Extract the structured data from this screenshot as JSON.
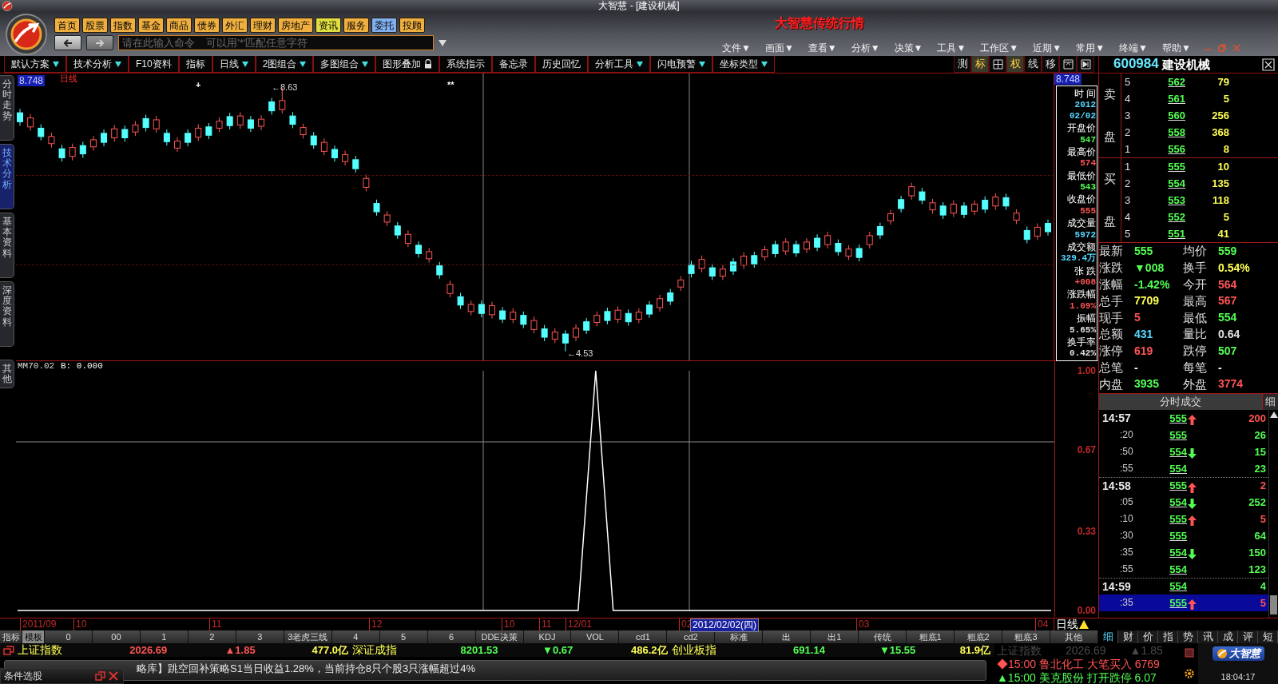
{
  "window": {
    "title": "大智慧 - [建设机械]"
  },
  "nav_buttons": [
    {
      "label": "首页",
      "color": "#f0b040"
    },
    {
      "label": "股票",
      "color": "#f0b040"
    },
    {
      "label": "指数",
      "color": "#f0b040"
    },
    {
      "label": "基金",
      "color": "#f0b040"
    },
    {
      "label": "商品",
      "color": "#f0b040"
    },
    {
      "label": "债券",
      "color": "#f0b040"
    },
    {
      "label": "外汇",
      "color": "#f0b040"
    },
    {
      "label": "理财",
      "color": "#f0b040"
    },
    {
      "label": "房地产",
      "color": "#f0b040"
    },
    {
      "label": "资讯",
      "color": "#e0e040"
    },
    {
      "label": "服务",
      "color": "#f0b040"
    },
    {
      "label": "委托",
      "color": "#80b0f0"
    },
    {
      "label": "投顾",
      "color": "#f0b040"
    }
  ],
  "command": {
    "placeholder": "请在此输入命令    可以用'*'匹配任意字符"
  },
  "brand": "大智慧传统行情",
  "menus": [
    "文件▼",
    "画面▼",
    "查看▼",
    "分析▼",
    "决策▼",
    "工具▼",
    "工作区▼",
    "近期▼",
    "常用▼",
    "终端▼",
    "帮助▼"
  ],
  "toolbar": [
    {
      "label": "默认方案",
      "dropdown": true,
      "lock": false
    },
    {
      "label": "技术分析",
      "dropdown": true,
      "lock": false
    },
    {
      "label": "F10资料",
      "dropdown": false,
      "lock": false
    },
    {
      "label": "指标",
      "dropdown": false,
      "lock": false
    },
    {
      "label": "日线",
      "dropdown": true,
      "lock": false
    },
    {
      "label": "2图组合",
      "dropdown": true,
      "lock": false
    },
    {
      "label": "多图组合",
      "dropdown": true,
      "lock": false
    },
    {
      "label": "图形叠加",
      "dropdown": false,
      "lock": true
    },
    {
      "label": "系统指示",
      "dropdown": false,
      "lock": false
    },
    {
      "label": "备忘录",
      "dropdown": false,
      "lock": false
    },
    {
      "label": "历史回忆",
      "dropdown": false,
      "lock": false
    },
    {
      "label": "分析工具",
      "dropdown": true,
      "lock": false
    },
    {
      "label": "闪电预警",
      "dropdown": true,
      "lock": false
    },
    {
      "label": "坐标类型",
      "dropdown": true,
      "lock": false
    }
  ],
  "chart_tools": [
    {
      "kind": "text",
      "label": "测",
      "selected": false
    },
    {
      "kind": "text",
      "label": "标",
      "selected": true
    },
    {
      "kind": "grid",
      "selected": false
    },
    {
      "kind": "text",
      "label": "权",
      "selected": true
    },
    {
      "kind": "text",
      "label": "线",
      "selected": false
    },
    {
      "kind": "text",
      "label": "移",
      "selected": false
    },
    {
      "kind": "panel",
      "selected": false
    },
    {
      "kind": "play",
      "selected": false
    }
  ],
  "stock": {
    "code": "600984",
    "name": "建设机械"
  },
  "side_tabs": [
    {
      "label": "分时走势",
      "selected": false
    },
    {
      "label": "技术分析",
      "selected": true
    },
    {
      "label": "基本资料",
      "selected": false
    },
    {
      "label": "深度资料",
      "selected": false
    }
  ],
  "lower_tab": "其他",
  "price_chart": {
    "period": "日线",
    "top_price": "8.748",
    "high": "←8.63",
    "low": "←4.53",
    "markers": [
      "+",
      "**"
    ],
    "chart_data": {
      "type": "candlestick",
      "ylim": [
        4.39,
        8.85
      ],
      "ohlc": [
        [
          8.24,
          8.3,
          8.04,
          8.1
        ],
        [
          8.02,
          8.22,
          7.96,
          8.16
        ],
        [
          8.0,
          8.06,
          7.81,
          7.87
        ],
        [
          7.76,
          7.93,
          7.7,
          7.87
        ],
        [
          7.68,
          7.74,
          7.48,
          7.54
        ],
        [
          7.56,
          7.76,
          7.5,
          7.7
        ],
        [
          7.73,
          7.79,
          7.54,
          7.6
        ],
        [
          7.71,
          7.88,
          7.65,
          7.82
        ],
        [
          7.92,
          7.98,
          7.72,
          7.78
        ],
        [
          7.85,
          8.05,
          7.79,
          7.99
        ],
        [
          7.98,
          8.04,
          7.79,
          7.85
        ],
        [
          7.94,
          8.11,
          7.88,
          8.05
        ],
        [
          8.15,
          8.21,
          7.95,
          8.01
        ],
        [
          7.99,
          8.19,
          7.93,
          8.13
        ],
        [
          7.92,
          7.98,
          7.73,
          7.79
        ],
        [
          7.69,
          7.86,
          7.63,
          7.8
        ],
        [
          7.92,
          7.98,
          7.72,
          7.78
        ],
        [
          7.86,
          8.06,
          7.8,
          8.0
        ],
        [
          8.02,
          8.08,
          7.83,
          7.89
        ],
        [
          8.0,
          8.17,
          7.94,
          8.11
        ],
        [
          8.18,
          8.24,
          7.98,
          8.04
        ],
        [
          8.05,
          8.25,
          7.99,
          8.19
        ],
        [
          8.13,
          8.19,
          7.94,
          8.0
        ],
        [
          8.03,
          8.2,
          7.97,
          8.14
        ],
        [
          8.41,
          8.47,
          8.21,
          8.27
        ],
        [
          8.29,
          8.63,
          8.23,
          8.43
        ],
        [
          8.19,
          8.25,
          8.0,
          8.06
        ],
        [
          7.9,
          8.07,
          7.84,
          8.01
        ],
        [
          7.88,
          7.94,
          7.68,
          7.74
        ],
        [
          7.64,
          7.84,
          7.58,
          7.78
        ],
        [
          7.67,
          7.73,
          7.48,
          7.54
        ],
        [
          7.48,
          7.65,
          7.42,
          7.59
        ],
        [
          7.51,
          7.57,
          7.31,
          7.37
        ],
        [
          7.08,
          7.28,
          7.02,
          7.22
        ],
        [
          6.83,
          6.89,
          6.64,
          6.7
        ],
        [
          6.54,
          6.71,
          6.48,
          6.65
        ],
        [
          6.48,
          6.54,
          6.28,
          6.34
        ],
        [
          6.21,
          6.41,
          6.15,
          6.35
        ],
        [
          6.18,
          6.24,
          5.99,
          6.05
        ],
        [
          5.97,
          6.14,
          5.91,
          6.08
        ],
        [
          5.86,
          5.92,
          5.66,
          5.72
        ],
        [
          5.43,
          5.63,
          5.37,
          5.57
        ],
        [
          5.38,
          5.44,
          5.19,
          5.25
        ],
        [
          5.15,
          5.32,
          5.09,
          5.26
        ],
        [
          5.26,
          5.32,
          5.06,
          5.12
        ],
        [
          5.1,
          5.3,
          5.04,
          5.24
        ],
        [
          5.16,
          5.22,
          4.97,
          5.03
        ],
        [
          5.03,
          5.2,
          4.97,
          5.14
        ],
        [
          5.09,
          5.15,
          4.89,
          4.95
        ],
        [
          4.87,
          5.07,
          4.81,
          5.01
        ],
        [
          4.88,
          4.94,
          4.69,
          4.75
        ],
        [
          4.72,
          4.89,
          4.66,
          4.83
        ],
        [
          4.8,
          4.86,
          4.53,
          4.66
        ],
        [
          4.75,
          4.95,
          4.69,
          4.89
        ],
        [
          4.99,
          5.05,
          4.8,
          4.86
        ],
        [
          4.98,
          5.15,
          4.92,
          5.09
        ],
        [
          5.15,
          5.21,
          4.95,
          5.01
        ],
        [
          5.03,
          5.23,
          4.97,
          5.17
        ],
        [
          5.12,
          5.18,
          4.93,
          4.99
        ],
        [
          5.03,
          5.2,
          4.97,
          5.14
        ],
        [
          5.25,
          5.31,
          5.05,
          5.11
        ],
        [
          5.21,
          5.41,
          5.15,
          5.35
        ],
        [
          5.44,
          5.5,
          5.25,
          5.31
        ],
        [
          5.53,
          5.7,
          5.47,
          5.64
        ],
        [
          5.88,
          5.94,
          5.68,
          5.74
        ],
        [
          5.82,
          6.02,
          5.76,
          5.96
        ],
        [
          5.83,
          5.89,
          5.64,
          5.7
        ],
        [
          5.7,
          5.87,
          5.64,
          5.81
        ],
        [
          5.92,
          5.98,
          5.72,
          5.78
        ],
        [
          5.87,
          6.07,
          5.81,
          6.01
        ],
        [
          6.02,
          6.08,
          5.83,
          5.89
        ],
        [
          6.0,
          6.17,
          5.94,
          6.11
        ],
        [
          6.19,
          6.25,
          5.99,
          6.05
        ],
        [
          6.09,
          6.29,
          6.03,
          6.23
        ],
        [
          6.19,
          6.25,
          6.0,
          6.06
        ],
        [
          6.12,
          6.29,
          6.06,
          6.23
        ],
        [
          6.29,
          6.35,
          6.09,
          6.15
        ],
        [
          6.19,
          6.39,
          6.13,
          6.33
        ],
        [
          6.21,
          6.27,
          6.02,
          6.08
        ],
        [
          6.01,
          6.18,
          5.95,
          6.12
        ],
        [
          6.13,
          6.19,
          5.93,
          5.99
        ],
        [
          6.19,
          6.39,
          6.13,
          6.33
        ],
        [
          6.47,
          6.53,
          6.28,
          6.34
        ],
        [
          6.56,
          6.73,
          6.5,
          6.67
        ],
        [
          6.89,
          6.95,
          6.69,
          6.75
        ],
        [
          6.95,
          7.15,
          6.89,
          7.09
        ],
        [
          7.01,
          7.07,
          6.82,
          6.88
        ],
        [
          6.73,
          6.9,
          6.67,
          6.84
        ],
        [
          6.79,
          6.85,
          6.59,
          6.65
        ],
        [
          6.68,
          6.88,
          6.62,
          6.82
        ],
        [
          6.79,
          6.85,
          6.6,
          6.66
        ],
        [
          6.71,
          6.88,
          6.65,
          6.82
        ],
        [
          6.88,
          6.94,
          6.68,
          6.74
        ],
        [
          6.79,
          6.99,
          6.73,
          6.93
        ],
        [
          6.92,
          6.98,
          6.73,
          6.79
        ],
        [
          6.57,
          6.74,
          6.51,
          6.68
        ],
        [
          6.41,
          6.47,
          6.21,
          6.27
        ],
        [
          6.32,
          6.52,
          6.26,
          6.46
        ],
        [
          6.52,
          6.58,
          6.33,
          6.39
        ]
      ]
    }
  },
  "axis_tag": "8.748",
  "info_box": [
    {
      "label": "时 间",
      "values": [
        "2012",
        "02/02"
      ],
      "color": "#54d8ff"
    },
    {
      "label": "开盘价",
      "values": [
        "547"
      ],
      "color": "#54ff54"
    },
    {
      "label": "最高价",
      "values": [
        "574"
      ],
      "color": "#ff5454"
    },
    {
      "label": "最低价",
      "values": [
        "543"
      ],
      "color": "#54ff54"
    },
    {
      "label": "收盘价",
      "values": [
        "555"
      ],
      "color": "#ff5454"
    },
    {
      "label": "成交量",
      "values": [
        "5972"
      ],
      "color": "#54d8ff"
    },
    {
      "label": "成交额",
      "values": [
        "329.4万"
      ],
      "color": "#54d8ff"
    },
    {
      "label": "张 跌",
      "values": [
        "+008"
      ],
      "color": "#ff5454"
    },
    {
      "label": "涨跌幅",
      "values": [
        "1.09%"
      ],
      "color": "#ff5454"
    },
    {
      "label": "振幅",
      "values": [
        "5.65%"
      ],
      "color": "#e0e0e0"
    },
    {
      "label": "换手率",
      "values": [
        "0.42%"
      ],
      "color": "#e0e0e0"
    }
  ],
  "order_book": {
    "sell_label": [
      "卖",
      "盘"
    ],
    "buy_label": [
      "买",
      "盘"
    ],
    "sell": [
      {
        "rank": "5",
        "price": "562",
        "volume": "79"
      },
      {
        "rank": "4",
        "price": "561",
        "volume": "5"
      },
      {
        "rank": "3",
        "price": "560",
        "volume": "256"
      },
      {
        "rank": "2",
        "price": "558",
        "volume": "368"
      },
      {
        "rank": "1",
        "price": "556",
        "volume": "8"
      }
    ],
    "buy": [
      {
        "rank": "1",
        "price": "555",
        "volume": "10"
      },
      {
        "rank": "2",
        "price": "554",
        "volume": "135"
      },
      {
        "rank": "3",
        "price": "553",
        "volume": "118"
      },
      {
        "rank": "4",
        "price": "552",
        "volume": "5"
      },
      {
        "rank": "5",
        "price": "551",
        "volume": "41"
      }
    ]
  },
  "quote": [
    {
      "label": "最新",
      "value": "555",
      "color": "#54ff54"
    },
    {
      "label": "均价",
      "value": "559",
      "color": "#54ff54"
    },
    {
      "label": "涨跌",
      "value": "▼008",
      "color": "#54ff54"
    },
    {
      "label": "换手",
      "value": "0.54%",
      "color": "#ffff54"
    },
    {
      "label": "涨幅",
      "value": "-1.42%",
      "color": "#54ff54"
    },
    {
      "label": "今开",
      "value": "564",
      "color": "#ff5454"
    },
    {
      "label": "总手",
      "value": "7709",
      "color": "#ffff54"
    },
    {
      "label": "最高",
      "value": "567",
      "color": "#ff5454"
    },
    {
      "label": "现手",
      "value": "5",
      "color": "#ff5454"
    },
    {
      "label": "最低",
      "value": "554",
      "color": "#54ff54"
    },
    {
      "label": "总额",
      "value": "431",
      "color": "#54d8ff"
    },
    {
      "label": "量比",
      "value": "0.64",
      "color": "#e0e0e0"
    },
    {
      "label": "涨停",
      "value": "619",
      "color": "#ff5454"
    },
    {
      "label": "跌停",
      "value": "507",
      "color": "#54ff54"
    },
    {
      "label": "总笔",
      "value": "-",
      "color": "#ffffff"
    },
    {
      "label": "每笔",
      "value": "-",
      "color": "#ffffff"
    },
    {
      "label": "内盘",
      "value": "3935",
      "color": "#54ff54"
    },
    {
      "label": "外盘",
      "value": "3774",
      "color": "#ff5454"
    }
  ],
  "ticks": {
    "title": "分时成交",
    "side_tab": "细",
    "rows": [
      {
        "time": "14:57",
        "price": "555",
        "kind": "up",
        "volume": "200",
        "color": "#ff5454",
        "major": true,
        "selected": false
      },
      {
        "time": ":20",
        "price": "555",
        "kind": "plain",
        "volume": "26",
        "color": "#54ff54",
        "major": false,
        "selected": false
      },
      {
        "time": ":50",
        "price": "554",
        "kind": "down",
        "volume": "15",
        "color": "#54ff54",
        "major": false,
        "selected": false
      },
      {
        "time": ":55",
        "price": "554",
        "kind": "plain",
        "volume": "23",
        "color": "#54ff54",
        "major": false,
        "selected": false
      },
      {
        "time": "14:58",
        "price": "555",
        "kind": "up",
        "volume": "2",
        "color": "#ff5454",
        "major": true,
        "selected": false
      },
      {
        "time": ":05",
        "price": "554",
        "kind": "down",
        "volume": "252",
        "color": "#54ff54",
        "major": false,
        "selected": false
      },
      {
        "time": ":10",
        "price": "555",
        "kind": "up",
        "volume": "5",
        "color": "#ff5454",
        "major": false,
        "selected": false
      },
      {
        "time": ":30",
        "price": "555",
        "kind": "plain",
        "volume": "64",
        "color": "#54ff54",
        "major": false,
        "selected": false
      },
      {
        "time": ":35",
        "price": "554",
        "kind": "down",
        "volume": "150",
        "color": "#54ff54",
        "major": false,
        "selected": false
      },
      {
        "time": ":55",
        "price": "554",
        "kind": "plain",
        "volume": "123",
        "color": "#54ff54",
        "major": false,
        "selected": false
      },
      {
        "time": "14:59",
        "price": "554",
        "kind": "plain",
        "volume": "4",
        "color": "#54ff54",
        "major": true,
        "selected": false
      },
      {
        "time": ":35",
        "price": "555",
        "kind": "up",
        "volume": "5",
        "color": "#ff5454",
        "major": false,
        "selected": true
      }
    ]
  },
  "indicator": {
    "name": "MM70.02",
    "reading": ": 0.000",
    "chart_data": {
      "type": "line",
      "ylim": [
        0,
        1
      ],
      "yticks": [
        {
          "value": 1,
          "label": "1.00"
        },
        {
          "value": 0.67,
          "label": "0.67"
        },
        {
          "value": 0.33,
          "label": "0.33"
        },
        {
          "value": 0,
          "label": "0.00"
        }
      ],
      "series": [
        {
          "name": "B",
          "color": "#ffffff",
          "values": [
            0,
            0,
            0,
            0,
            0,
            0,
            0,
            0,
            0,
            0,
            0,
            0,
            0,
            0,
            0,
            0,
            0,
            0,
            0,
            0,
            0,
            0,
            0,
            0,
            0,
            0,
            0,
            0,
            0,
            0,
            0,
            0,
            0,
            1,
            0,
            0,
            0,
            0,
            0,
            0,
            0,
            0,
            0,
            0,
            0,
            0,
            0,
            0,
            0,
            0,
            0,
            0,
            0,
            0,
            0,
            0,
            0,
            0,
            0,
            0
          ]
        }
      ]
    }
  },
  "date_axis": {
    "labels": [
      "2011/09",
      "10",
      "11",
      "12",
      "10",
      "11",
      "12/01",
      "02",
      "03",
      "04"
    ],
    "cursor": "2012/02/02(四)",
    "period": "日线"
  },
  "indicator_tabs": [
    {
      "label": "指标",
      "selected": false
    },
    {
      "label": "模板",
      "selected": true
    },
    {
      "label": "0",
      "selected": false
    },
    {
      "label": "00",
      "selected": false
    },
    {
      "label": "1",
      "selected": false
    },
    {
      "label": "2",
      "selected": false
    },
    {
      "label": "3",
      "selected": false
    },
    {
      "label": "3老虎三线",
      "selected": false
    },
    {
      "label": "4",
      "selected": false
    },
    {
      "label": "5",
      "selected": false
    },
    {
      "label": "6",
      "selected": false
    },
    {
      "label": "DDE决策",
      "selected": false
    },
    {
      "label": "KDJ",
      "selected": false
    },
    {
      "label": "VOL",
      "selected": false
    },
    {
      "label": "cd1",
      "selected": false
    },
    {
      "label": "cd2",
      "selected": false
    },
    {
      "label": "标准",
      "selected": false
    },
    {
      "label": "出",
      "selected": false
    },
    {
      "label": "出1",
      "selected": false
    },
    {
      "label": "传统",
      "selected": false
    },
    {
      "label": "粗底1",
      "selected": false
    },
    {
      "label": "粗底2",
      "selected": false
    },
    {
      "label": "粗底3",
      "selected": false
    },
    {
      "label": "其他",
      "selected": false
    }
  ],
  "panel_tabs": [
    {
      "label": "细",
      "selected": true
    },
    {
      "label": "财",
      "selected": false
    },
    {
      "label": "价",
      "selected": false
    },
    {
      "label": "指",
      "selected": false
    },
    {
      "label": "势",
      "selected": false
    },
    {
      "label": "讯",
      "selected": false
    },
    {
      "label": "成",
      "selected": false
    },
    {
      "label": "评",
      "selected": false
    },
    {
      "label": "短",
      "selected": false
    }
  ],
  "ticker": [
    {
      "name": "上证指数",
      "value": "2026.69",
      "change": "▲1.85",
      "color": "#ff5454",
      "amount": "477.0亿"
    },
    {
      "name": "深证成指",
      "value": "8201.53",
      "change": "▼0.67",
      "color": "#54ff54",
      "amount": "486.2亿"
    },
    {
      "name": "创业板指",
      "value": "691.14",
      "change": "▼15.55",
      "color": "#54ff54",
      "amount": "81.9亿"
    }
  ],
  "message": "略库】跳空回补策略S1当日收益1.28%，当前持仓8只个股3只涨幅超过4%",
  "float_panel": {
    "title": "条件选股"
  },
  "alerts": {
    "faded": [
      "上证指数",
      "2026.69",
      "▲1.85"
    ],
    "items": [
      {
        "mark": "◆",
        "time": "15:00",
        "text": "鲁北化工 大笔买入 6769",
        "color": "#ff5454"
      },
      {
        "mark": "▲",
        "time": "15:00",
        "text": "美克股份 打开跌停 6.07",
        "color": "#54ff54"
      }
    ]
  },
  "clock": {
    "logo": "大智慧",
    "time": "18:04:17"
  }
}
